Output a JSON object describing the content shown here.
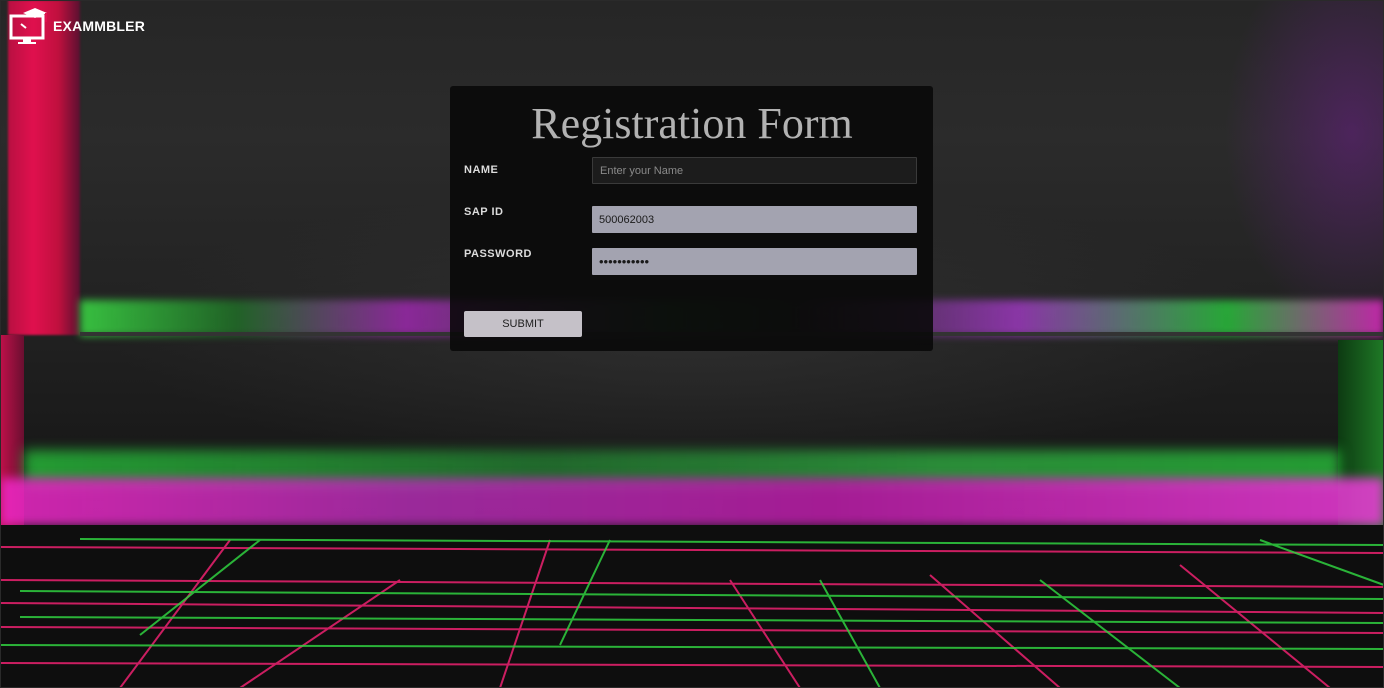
{
  "brand": {
    "name": "EXAMMBLER",
    "logo_icon": "monitor-graduation-cap-icon"
  },
  "form": {
    "title": "Registration Form",
    "fields": {
      "name": {
        "label": "NAME",
        "placeholder": "Enter your Name",
        "value": ""
      },
      "sap_id": {
        "label": "SAP ID",
        "value": "500062003"
      },
      "password": {
        "label": "PASSWORD",
        "value": "•••••••••••"
      }
    },
    "submit_label": "SUBMIT"
  },
  "colors": {
    "panel_bg": "#080808",
    "filled_input_bg": "#a3a3b0",
    "submit_bg": "#c5c1c8",
    "title_color": "#b2b2b2",
    "neon_pink": "#e0104e",
    "neon_magenta": "#f028c8",
    "neon_green": "#28c83c"
  }
}
